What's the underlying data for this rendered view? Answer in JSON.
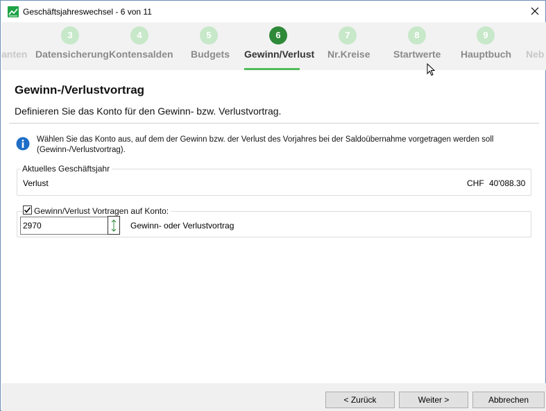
{
  "window": {
    "title": "Geschäftsjahreswechsel - 6 von 11",
    "app_icon": "chart-icon",
    "close_icon": "close-icon"
  },
  "steps": [
    {
      "number": "",
      "label": "anten"
    },
    {
      "number": "3",
      "label": "Datensicherung"
    },
    {
      "number": "4",
      "label": "Kontensalden"
    },
    {
      "number": "5",
      "label": "Budgets"
    },
    {
      "number": "6",
      "label": "Gewinn/Verlust"
    },
    {
      "number": "7",
      "label": "Nr.Kreise"
    },
    {
      "number": "8",
      "label": "Startwerte"
    },
    {
      "number": "9",
      "label": "Hauptbuch"
    },
    {
      "number": "",
      "label": "Neb"
    }
  ],
  "page": {
    "heading": "Gewinn-/Verlustvortrag",
    "subheading": "Definieren Sie das Konto für den Gewinn- bzw. Verlustvortrag.",
    "info_text": "Wählen Sie das Konto aus, auf dem der Gewinn bzw. der Verlust des Vorjahres bei der Saldoübernahme vorgetragen  werden soll (Gewinn-/Verlustvortrag)."
  },
  "current_year": {
    "legend": "Aktuelles Geschäftsjahr",
    "label": "Verlust",
    "currency": "CHF",
    "amount": "40'088.30"
  },
  "carry_forward": {
    "checkbox_label": "Gewinn/Verlust Vortragen auf Konto:",
    "checked": true,
    "account_value": "2970",
    "account_description": "Gewinn- oder Verlustvortrag"
  },
  "buttons": {
    "back": "< Zurück",
    "next": "Weiter >",
    "cancel": "Abbrechen"
  },
  "colors": {
    "active_step": "#2e8a39",
    "inactive_step": "#c7e8c9",
    "underline": "#4fbb57",
    "info_icon": "#1e6ec8"
  }
}
